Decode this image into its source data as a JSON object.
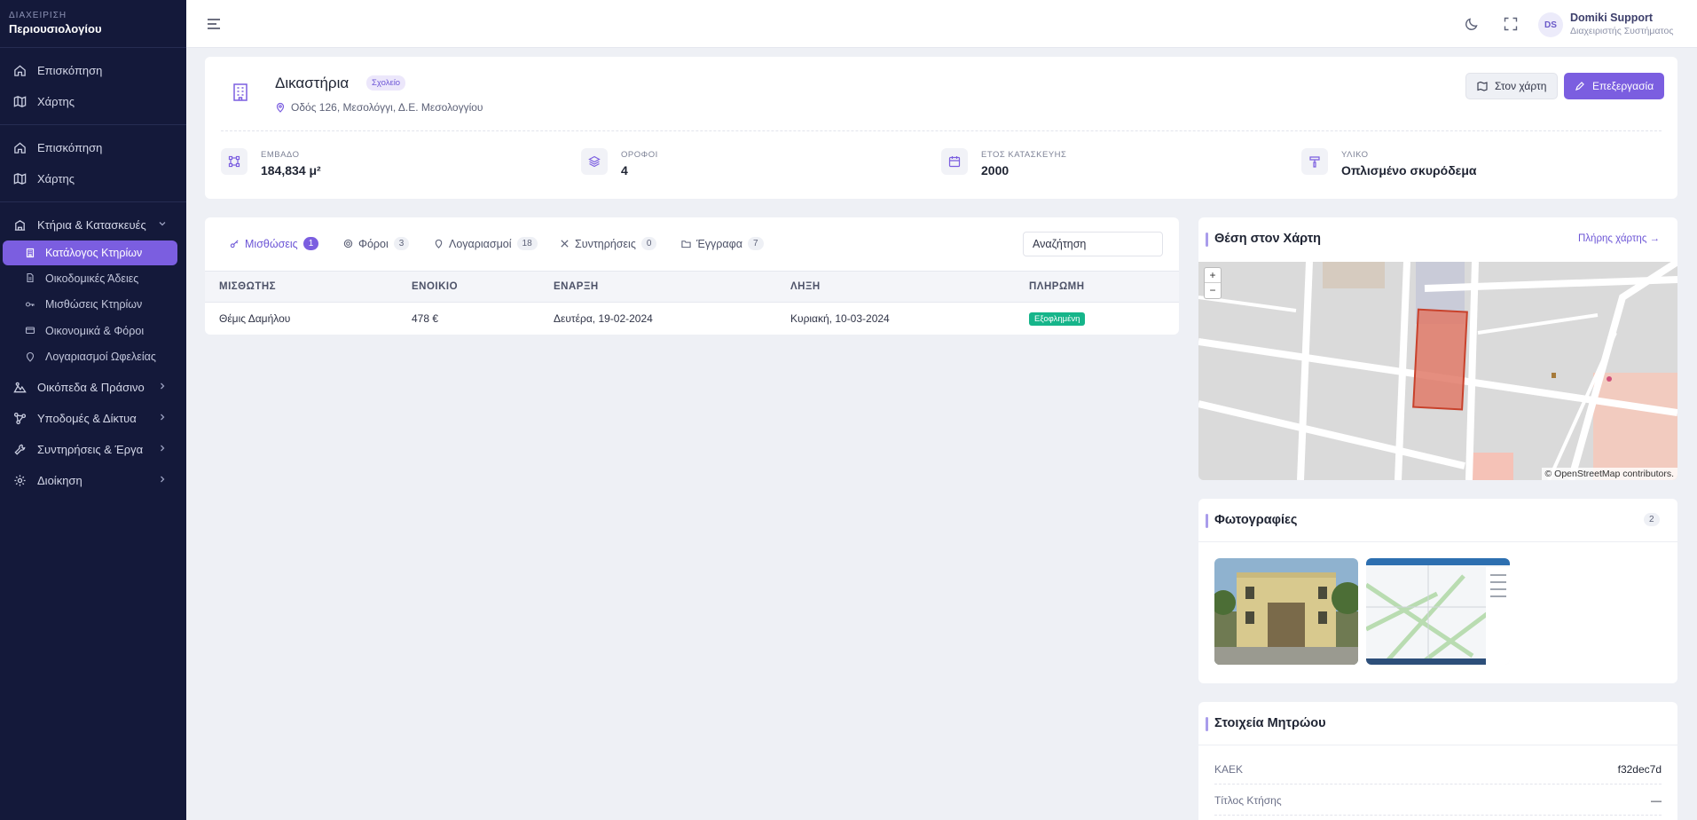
{
  "brand": {
    "small": "ΔΙΑΧΕΙΡΙΣΗ",
    "big": "Περιουσιολογίου"
  },
  "sidebar": {
    "top_items": [
      {
        "label": "Επισκόπηση",
        "icon": "home-icon"
      },
      {
        "label": "Χάρτης",
        "icon": "map-icon"
      }
    ],
    "mid_items": [
      {
        "label": "Επισκόπηση",
        "icon": "home-icon"
      },
      {
        "label": "Χάρτης",
        "icon": "map-icon"
      }
    ],
    "buildings_group": "Κτήρια & Κατασκευές",
    "buildings_sub": [
      {
        "label": "Κατάλογος Κτηρίων",
        "active": true
      },
      {
        "label": "Οικοδομικές Άδειες"
      },
      {
        "label": "Μισθώσεις Κτηρίων"
      },
      {
        "label": "Οικονομικά & Φόροι"
      },
      {
        "label": "Λογαριασμοί Ωφελείας"
      }
    ],
    "groups": [
      {
        "label": "Οικόπεδα & Πράσινο",
        "icon": "land-icon"
      },
      {
        "label": "Υποδομές & Δίκτυα",
        "icon": "network-icon"
      },
      {
        "label": "Συντηρήσεις & Έργα",
        "icon": "wrench-icon"
      },
      {
        "label": "Διοίκηση",
        "icon": "gear-icon"
      }
    ]
  },
  "user": {
    "initials": "DS",
    "name": "Domiki Support",
    "role": "Διαχειριστής Συστήματος"
  },
  "building": {
    "title": "Δικαστήρια",
    "type": "Σχολείο",
    "address": "Οδός 126, Μεσολόγγι, Δ.Ε. Μεσολογγίου",
    "map_button": "Στον χάρτη",
    "edit_button": "Επεξεργασία"
  },
  "stats": [
    {
      "label": "ΕΜΒΑΔΟ",
      "value": "184,834 μ²",
      "icon": "area-icon"
    },
    {
      "label": "ΟΡΟΦΟΙ",
      "value": "4",
      "icon": "layers-icon"
    },
    {
      "label": "ΕΤΟΣ ΚΑΤΑΣΚΕΥΗΣ",
      "value": "2000",
      "icon": "calendar-icon"
    },
    {
      "label": "ΥΛΙΚΟ",
      "value": "Οπλισμένο σκυρόδεμα",
      "icon": "trowel-icon"
    }
  ],
  "tabs": [
    {
      "label": "Μισθώσεις",
      "count": "1",
      "active": true
    },
    {
      "label": "Φόροι",
      "count": "3"
    },
    {
      "label": "Λογαριασμοί",
      "count": "18"
    },
    {
      "label": "Συντηρήσεις",
      "count": "0"
    },
    {
      "label": "Έγγραφα",
      "count": "7"
    }
  ],
  "search": {
    "value": "Αναζήτηση"
  },
  "table": {
    "headers": [
      "ΜΙΣΘΩΤΗΣ",
      "ΕΝΟΙΚΙΟ",
      "ΕΝΑΡΞΗ",
      "ΛΗΞΗ",
      "ΠΛΗΡΩΜΗ"
    ],
    "rows": [
      {
        "tenant": "Θέμις Δαμήλου",
        "rent": "478 €",
        "start": "Δευτέρα, 19-02-2024",
        "end": "Κυριακή, 10-03-2024",
        "payment": "Εξοφλημένη"
      }
    ]
  },
  "map": {
    "title": "Θέση στον Χάρτη",
    "full_link": "Πλήρης χάρτης →",
    "zoom_in": "+",
    "zoom_out": "−",
    "attribution": "© OpenStreetMap contributors."
  },
  "photos": {
    "title": "Φωτογραφίες",
    "count": "2"
  },
  "registry": {
    "title": "Στοιχεία Μητρώου",
    "rows": [
      {
        "key": "ΚΑΕΚ",
        "value": "f32dec7d"
      },
      {
        "key": "Τίτλος Κτήσης",
        "value": "—"
      }
    ]
  },
  "colors": {
    "accent": "#7b5ee0",
    "sidebar": "#14193a",
    "paid": "#16b58a",
    "parcel": "#e07a68"
  }
}
